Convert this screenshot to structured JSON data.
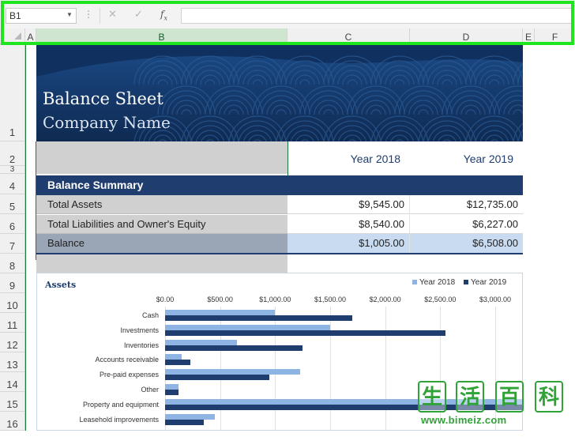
{
  "formula_bar": {
    "name_box": "B1",
    "formula": ""
  },
  "columns": [
    "A",
    "B",
    "C",
    "D",
    "E",
    "F"
  ],
  "rows": [
    "1",
    "2",
    "3",
    "4",
    "5",
    "6",
    "7",
    "8",
    "9",
    "10",
    "11",
    "12",
    "13",
    "14",
    "15",
    "16"
  ],
  "banner": {
    "title": "Balance Sheet",
    "subtitle": "Company Name"
  },
  "table": {
    "year_headers": [
      "Year 2018",
      "Year 2019"
    ],
    "section_title": "Balance Summary",
    "rows": [
      {
        "label": "Total Assets",
        "y2018": "$9,545.00",
        "y2019": "$12,735.00"
      },
      {
        "label": "Total Liabilities and Owner's Equity",
        "y2018": "$8,540.00",
        "y2019": "$6,227.00"
      },
      {
        "label": "Balance",
        "y2018": "$1,005.00",
        "y2019": "$6,508.00"
      }
    ]
  },
  "colors": {
    "dark_navy": "#143462",
    "light_blue_bar": "#8eb4e3",
    "dark_blue_bar": "#1f3d6e",
    "selection_green": "#1a7a3a",
    "highlight_green": "#1ee51e"
  },
  "chart_data": {
    "type": "bar",
    "title": "Assets",
    "orientation": "horizontal",
    "categories": [
      "Cash",
      "Investments",
      "Inventories",
      "Accounts receivable",
      "Pre-paid expenses",
      "Other",
      "Property and equipment",
      "Leasehold improvements"
    ],
    "series": [
      {
        "name": "Year 2018",
        "values": [
          1000,
          1500,
          650,
          150,
          1230,
          120,
          3300,
          450
        ]
      },
      {
        "name": "Year 2019",
        "values": [
          1700,
          2550,
          1250,
          230,
          950,
          120,
          3300,
          350
        ]
      }
    ],
    "xlim": [
      0,
      3000
    ],
    "ticks": [
      "$0.00",
      "$500.00",
      "$1,000.00",
      "$1,500.00",
      "$2,000.00",
      "$2,500.00",
      "$3,000.00"
    ],
    "legend_position": "top-right"
  },
  "watermark": {
    "chars": [
      "生",
      "活",
      "百",
      "科"
    ],
    "url": "www.bimeiz.com"
  }
}
